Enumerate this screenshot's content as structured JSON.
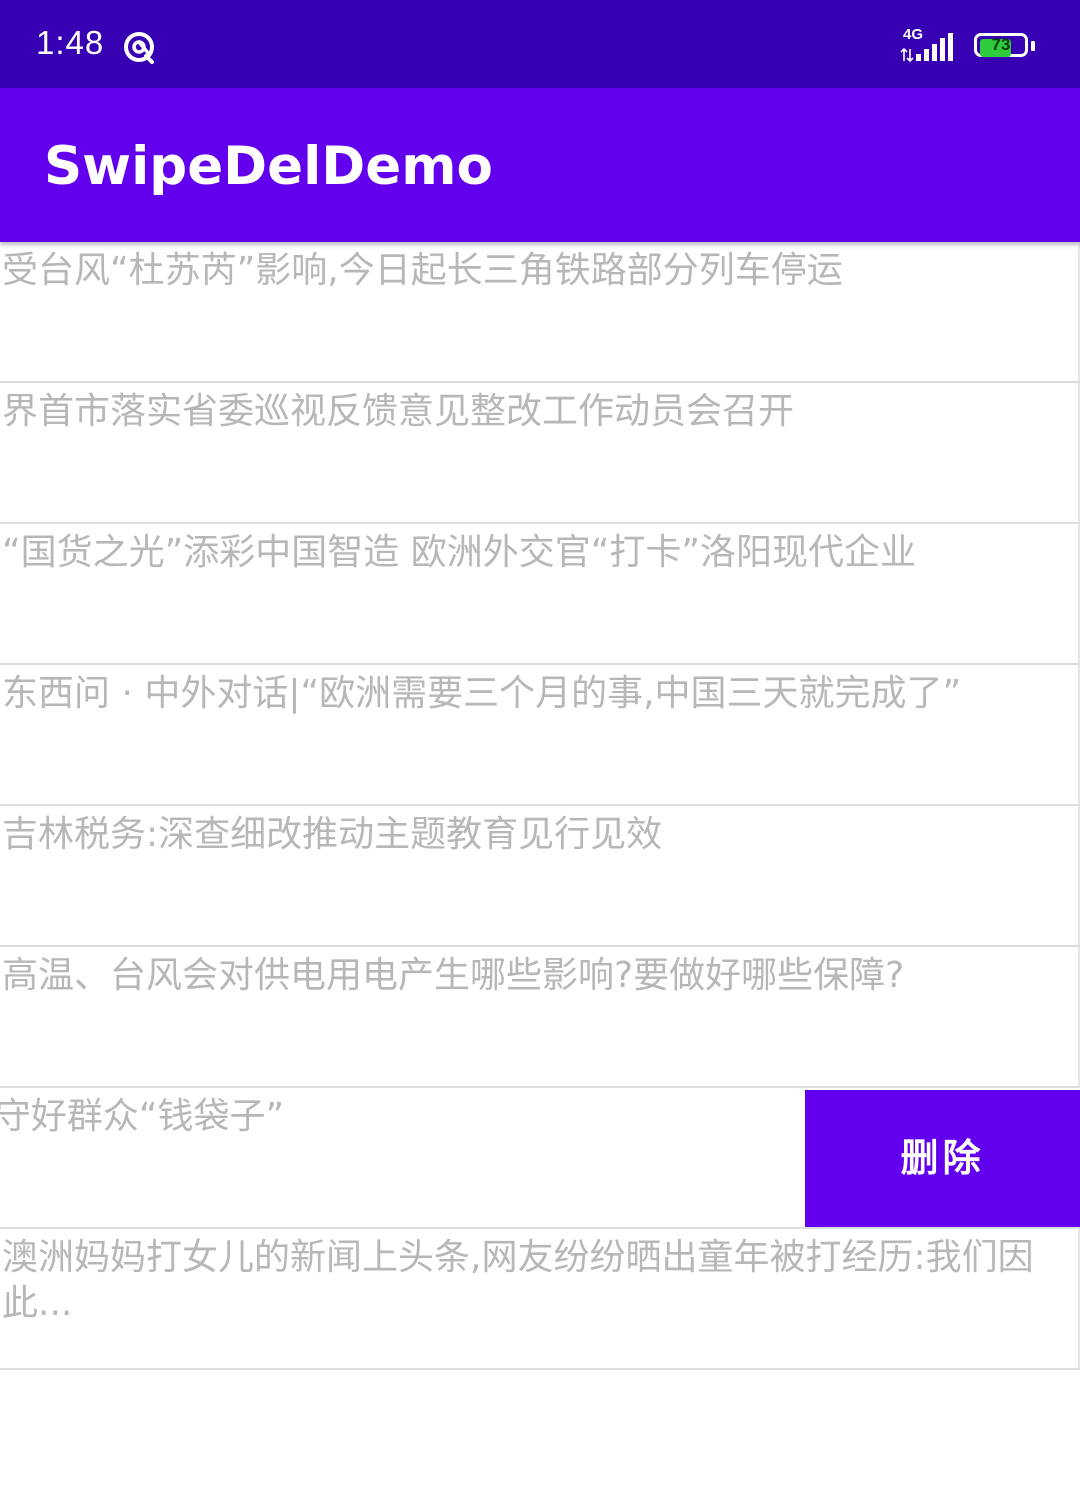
{
  "status_bar": {
    "time": "1:48",
    "network": "4G",
    "battery": "73",
    "battery_level_pct": 73,
    "icons": [
      "sync-icon",
      "data-arrows-icon",
      "signal-icon",
      "battery-icon"
    ]
  },
  "app_bar": {
    "title": "SwipeDelDemo",
    "color": "#6200ee"
  },
  "list": {
    "items": [
      {
        "text": "受台风“杜苏芮”影响,今日起长三角铁路部分列车停运"
      },
      {
        "text": "界首市落实省委巡视反馈意见整改工作动员会召开"
      },
      {
        "text": "“国货之光”添彩中国智造 欧洲外交官“打卡”洛阳现代企业"
      },
      {
        "text": "东西问 · 中外对话|“欧洲需要三个月的事,中国三天就完成了”"
      },
      {
        "text": "吉林税务:深查细改推动主题教育见行见效"
      },
      {
        "text": "高温、台风会对供电用电产生哪些影响?要做好哪些保障?"
      },
      {
        "text": "县:念好“紧箍咒” 守好群众“钱袋子”",
        "delete_label": "删除"
      },
      {
        "text": "澳洲妈妈打女儿的新闻上头条,网友纷纷晒出童年被打经历:我们因此..."
      }
    ]
  },
  "colors": {
    "status_bar": "#3700b3",
    "primary": "#6200ee",
    "item_text": "#b7b7b7",
    "divider": "#dddddd",
    "battery_fill": "#2ecc3a"
  }
}
